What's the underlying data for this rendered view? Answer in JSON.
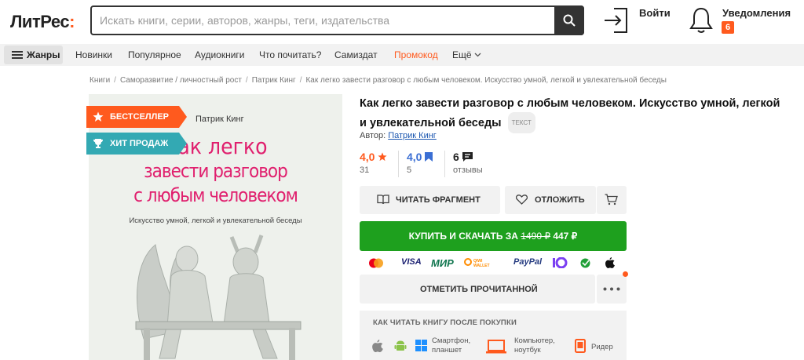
{
  "header": {
    "logo_part1": "Лит",
    "logo_part2": "Рес",
    "logo_colon": ":",
    "search_placeholder": "Искать книги, серии, авторов, жанры, теги, издательства",
    "login_label": "Войти",
    "notifications_label": "Уведомления",
    "notifications_count": "6"
  },
  "nav": {
    "genres_label": "Жанры",
    "items": [
      "Новинки",
      "Популярное",
      "Аудиокниги",
      "Что почитать?",
      "Самиздат",
      "Промокод",
      "Ещё"
    ],
    "promo_color": "#ff5a1e"
  },
  "breadcrumbs": [
    "Книги",
    "Саморазвитие / личностный рост",
    "Патрик Кинг",
    "Как легко завести разговор с любым человеком. Искусство умной, легкой и увлекательной беседы"
  ],
  "cover": {
    "author": "Патрик Кинг",
    "title_line1": "Как легко",
    "title_line2": "завести разговор",
    "title_line3": "с любым человеком",
    "subtitle": "Искусство умной, легкой и увлекательной беседы",
    "badge_bestseller": "БЕСТСЕЛЛЕР",
    "badge_hit": "ХИТ ПРОДАЖ"
  },
  "book": {
    "title": "Как легко завести разговор с любым человеком. Искусство умной, легкой и увлекательной беседы",
    "format_tag": "ТЕКСТ",
    "author_label": "Автор:",
    "author_name": "Патрик Кинг"
  },
  "ratings": {
    "litres_score": "4,0",
    "litres_count": "31",
    "livelib_score": "4,0",
    "livelib_count": "5",
    "reviews_count": "6",
    "reviews_label": "отзывы"
  },
  "actions": {
    "read_fragment": "ЧИТАТЬ ФРАГМЕНТ",
    "postpone": "ОТЛОЖИТЬ",
    "buy_label": "КУПИТЬ И СКАЧАТЬ ЗА",
    "old_price": "1490 ₽",
    "new_price": "447 ₽",
    "mark_read": "ОТМЕТИТЬ ПРОЧИТАННОЙ"
  },
  "payments": [
    "VISA",
    "МИР",
    "QIWI WALLET",
    "PayPal",
    "ЮMoney"
  ],
  "howto": {
    "heading": "КАК ЧИТАТЬ КНИГУ ПОСЛЕ ПОКУПКИ",
    "dev1": "Смартфон,",
    "dev1b": "планшет",
    "dev2": "Компьютер,",
    "dev2b": "ноутбук",
    "dev3": "Ридер"
  }
}
